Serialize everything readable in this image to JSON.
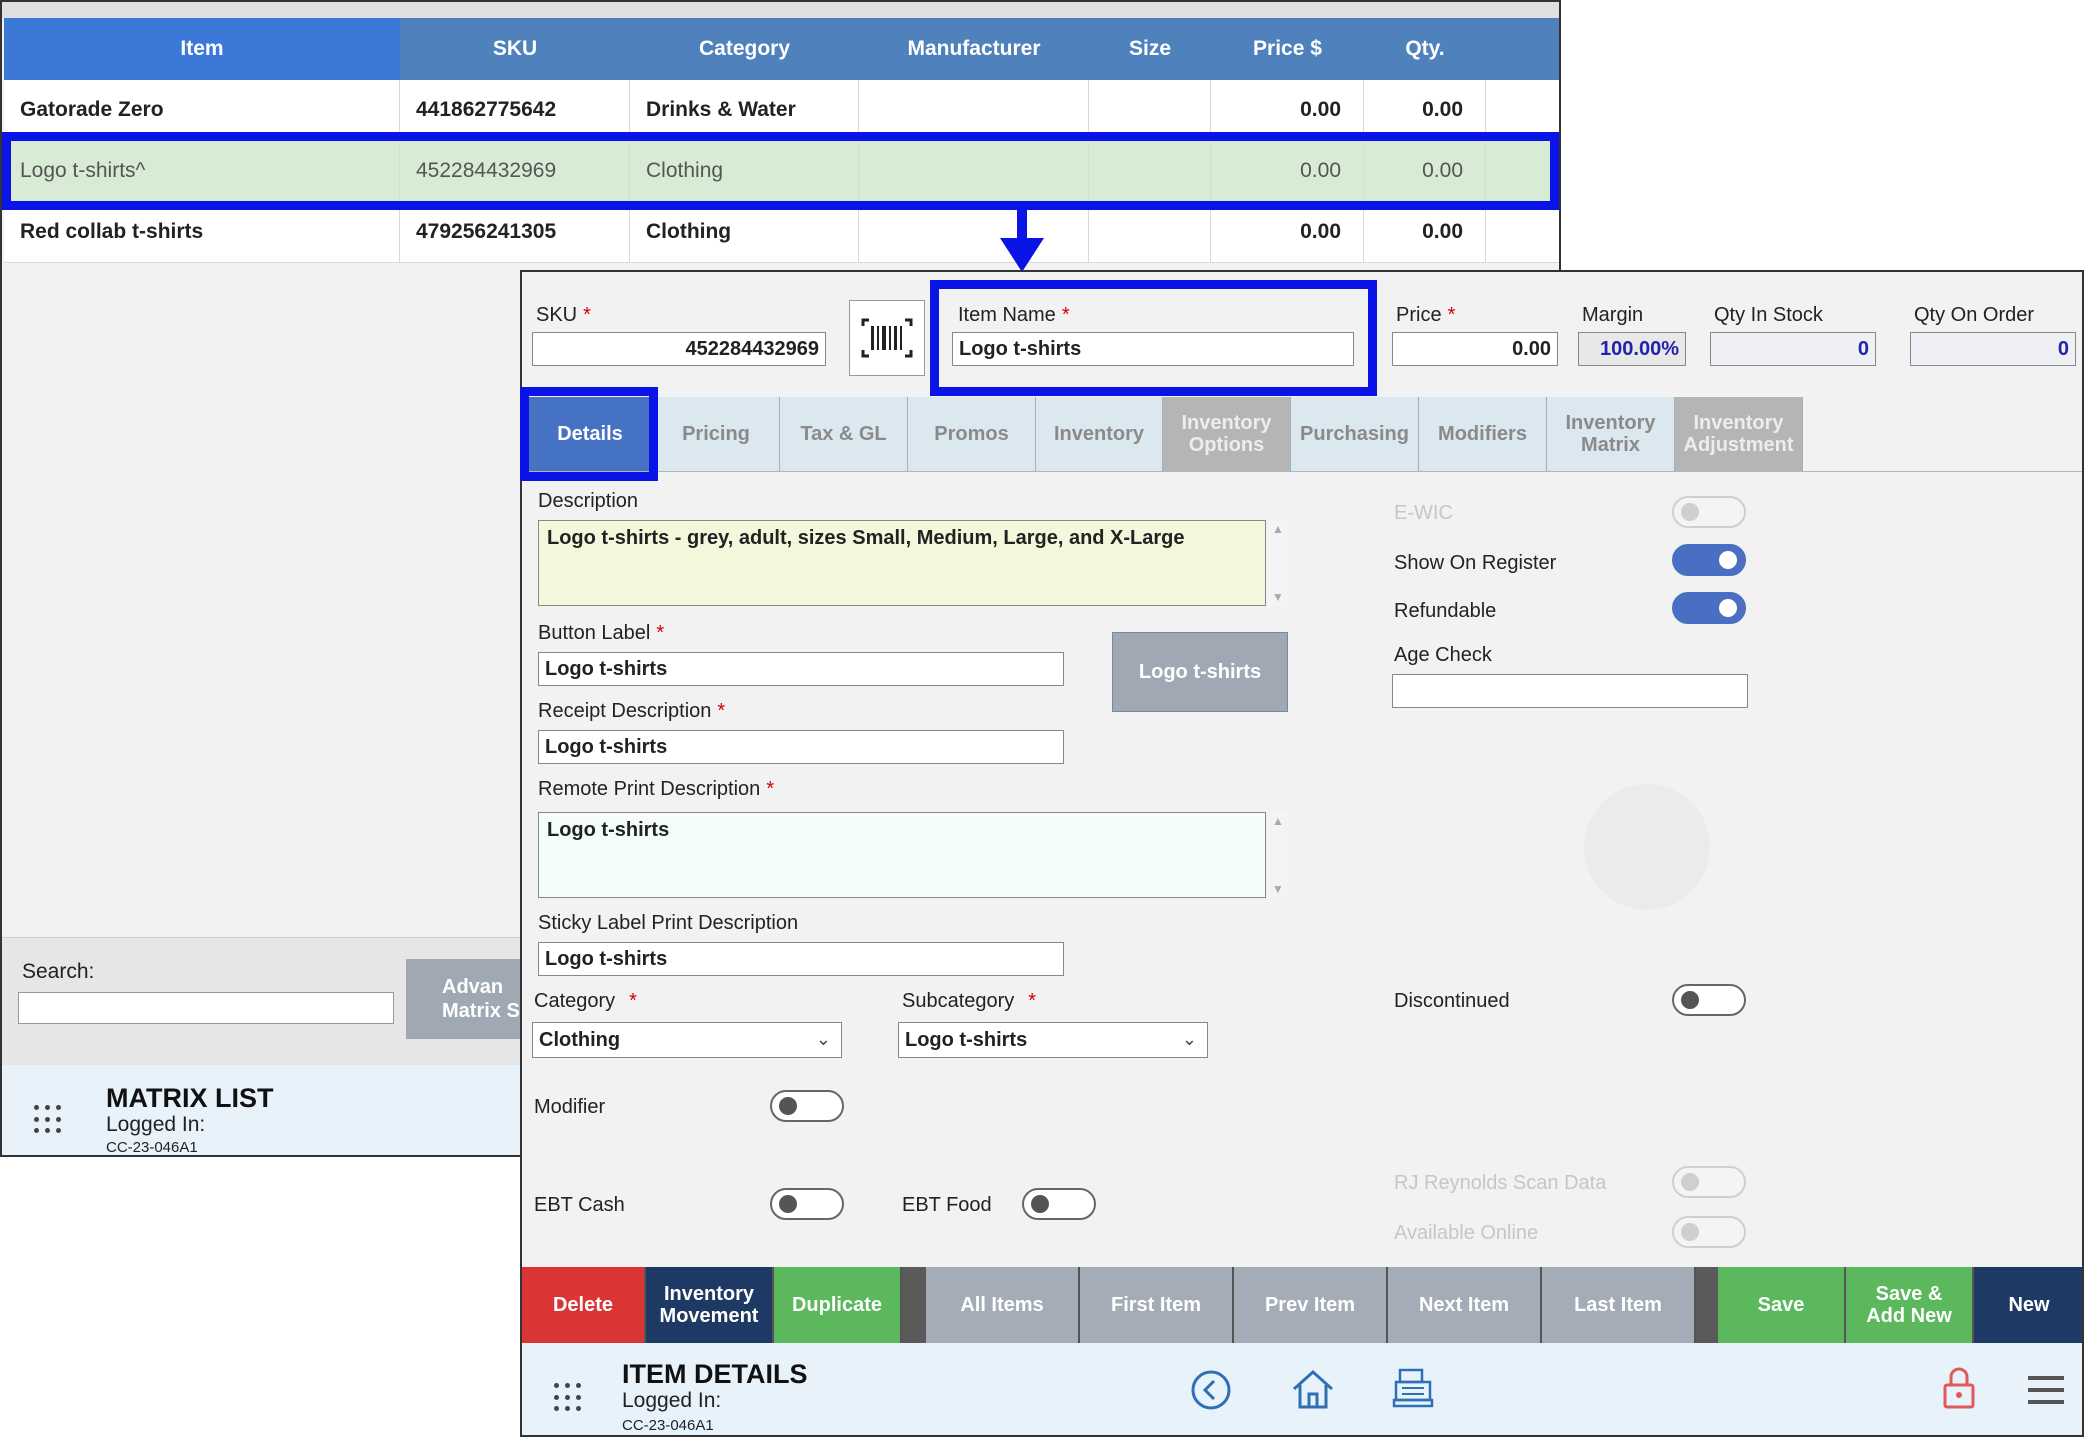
{
  "matrix_list": {
    "columns": [
      "Item",
      "SKU",
      "Category",
      "Manufacturer",
      "Size",
      "Price $",
      "Qty."
    ],
    "rows": [
      {
        "item": "Gatorade Zero",
        "sku": "441862775642",
        "category": "Drinks & Water",
        "manufacturer": "",
        "size": "",
        "price": "0.00",
        "qty": "0.00"
      },
      {
        "item": "Logo t-shirts^",
        "sku": "452284432969",
        "category": "Clothing",
        "manufacturer": "",
        "size": "",
        "price": "0.00",
        "qty": "0.00"
      },
      {
        "item": "Red collab t-shirts",
        "sku": "479256241305",
        "category": "Clothing",
        "manufacturer": "",
        "size": "",
        "price": "0.00",
        "qty": "0.00"
      }
    ],
    "search_label": "Search:",
    "search_value": "",
    "advanced_button": [
      "Advan",
      "Matrix S"
    ],
    "footer": {
      "title": "MATRIX LIST",
      "logged_in": "Logged In:",
      "code": "CC-23-046A1"
    }
  },
  "item_details": {
    "sku_label": "SKU",
    "sku_value": "452284432969",
    "item_name_label": "Item Name",
    "item_name_value": "Logo t-shirts",
    "price_label": "Price",
    "price_value": "0.00",
    "margin_label": "Margin",
    "margin_value": "100.00%",
    "qty_in_stock_label": "Qty In Stock",
    "qty_in_stock_value": "0",
    "qty_on_order_label": "Qty On Order",
    "qty_on_order_value": "0",
    "tabs": [
      {
        "line1": "Details",
        "line2": "",
        "state": "active"
      },
      {
        "line1": "Pricing",
        "line2": "",
        "state": "normal"
      },
      {
        "line1": "Tax & GL",
        "line2": "",
        "state": "normal"
      },
      {
        "line1": "Promos",
        "line2": "",
        "state": "normal"
      },
      {
        "line1": "Inventory",
        "line2": "",
        "state": "normal"
      },
      {
        "line1": "Inventory",
        "line2": "Options",
        "state": "disabled"
      },
      {
        "line1": "Purchasing",
        "line2": "",
        "state": "normal"
      },
      {
        "line1": "Modifiers",
        "line2": "",
        "state": "normal"
      },
      {
        "line1": "Inventory",
        "line2": "Matrix",
        "state": "normal"
      },
      {
        "line1": "Inventory",
        "line2": "Adjustment",
        "state": "disabled"
      }
    ],
    "description_label": "Description",
    "description_value": "Logo t-shirts - grey, adult, sizes Small, Medium, Large, and X-Large",
    "button_label_label": "Button Label",
    "button_label_value": "Logo t-shirts",
    "button_preview": "Logo t-shirts",
    "receipt_description_label": "Receipt Description",
    "receipt_description_value": "Logo t-shirts",
    "remote_print_label": "Remote Print Description",
    "remote_print_value": "Logo t-shirts",
    "sticky_label_label": "Sticky Label Print Description",
    "sticky_label_value": "Logo t-shirts",
    "category_label": "Category",
    "category_value": "Clothing",
    "subcategory_label": "Subcategory",
    "subcategory_value": "Logo t-shirts",
    "modifier_label": "Modifier",
    "ebt_cash_label": "EBT Cash",
    "ebt_food_label": "EBT Food",
    "ewic_label": "E-WIC",
    "show_on_register_label": "Show On Register",
    "refundable_label": "Refundable",
    "age_check_label": "Age Check",
    "age_check_value": "",
    "discontinued_label": "Discontinued",
    "rj_reynolds_label": "RJ Reynolds Scan Data",
    "available_online_label": "Available Online",
    "buttons": {
      "delete": "Delete",
      "inventory_movement": [
        "Inventory",
        "Movement"
      ],
      "duplicate": "Duplicate",
      "all_items": "All Items",
      "first_item": "First Item",
      "prev_item": "Prev Item",
      "next_item": "Next Item",
      "last_item": "Last Item",
      "save": "Save",
      "save_add_new": [
        "Save &",
        "Add New"
      ],
      "new": "New"
    },
    "footer": {
      "title": "ITEM DETAILS",
      "logged_in": "Logged In:",
      "code": "CC-23-046A1"
    }
  },
  "colors": {
    "highlight": "#0a14e6",
    "header_blue": "#4f81bd",
    "active_tab": "#4672c4",
    "toggle_on": "#4a6fc2",
    "delete_red": "#db3434",
    "save_green": "#5cb85c",
    "navy": "#1e3a64"
  },
  "icons": [
    "barcode-icon",
    "back-arrow-icon",
    "home-icon",
    "register-icon",
    "lock-icon",
    "menu-icon",
    "apps-grid-icon"
  ]
}
